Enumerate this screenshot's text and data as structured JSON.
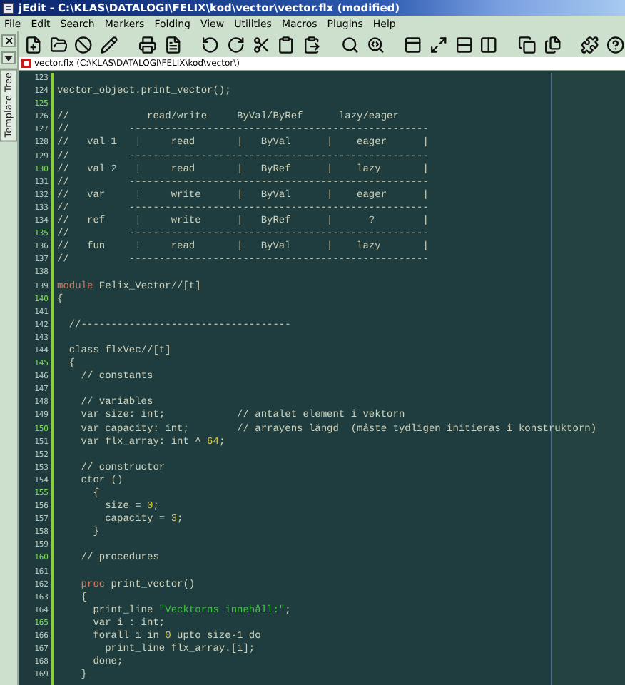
{
  "window": {
    "title": "jEdit - C:\\KLAS\\DATALOGI\\FELIX\\kod\\vector\\vector.flx (modified)"
  },
  "menu": [
    "File",
    "Edit",
    "Search",
    "Markers",
    "Folding",
    "View",
    "Utilities",
    "Macros",
    "Plugins",
    "Help"
  ],
  "dock": {
    "tab": "Template Tree"
  },
  "buffer": {
    "label": "vector.flx (C:\\KLAS\\DATALOGI\\FELIX\\kod\\vector\\)",
    "modified": true
  },
  "lines": [
    {
      "number": "123",
      "highlight": false
    },
    {
      "number": "124",
      "highlight": false,
      "tokens": [
        {
          "kind": "code",
          "text": "vector_object.print_vector();"
        }
      ]
    },
    {
      "number": "125",
      "highlight": true
    },
    {
      "number": "126",
      "highlight": false,
      "tokens": [
        {
          "kind": "code",
          "text": "//             read/write     ByVal/ByRef      lazy/eager"
        }
      ]
    },
    {
      "number": "127",
      "highlight": false,
      "tokens": [
        {
          "kind": "code",
          "text": "//          --------------------------------------------------"
        }
      ]
    },
    {
      "number": "128",
      "highlight": false,
      "tokens": [
        {
          "kind": "code",
          "text": "//   val 1   |     read       |   ByVal      |    eager      |"
        }
      ]
    },
    {
      "number": "129",
      "highlight": false,
      "tokens": [
        {
          "kind": "code",
          "text": "//          --------------------------------------------------"
        }
      ]
    },
    {
      "number": "130",
      "highlight": true,
      "tokens": [
        {
          "kind": "code",
          "text": "//   val 2   |     read       |   ByRef      |    lazy       |"
        }
      ]
    },
    {
      "number": "131",
      "highlight": false,
      "tokens": [
        {
          "kind": "code",
          "text": "//          --------------------------------------------------"
        }
      ]
    },
    {
      "number": "132",
      "highlight": false,
      "tokens": [
        {
          "kind": "code",
          "text": "//   var     |     write      |   ByVal      |    eager      |"
        }
      ]
    },
    {
      "number": "133",
      "highlight": false,
      "tokens": [
        {
          "kind": "code",
          "text": "//          --------------------------------------------------"
        }
      ]
    },
    {
      "number": "134",
      "highlight": false,
      "tokens": [
        {
          "kind": "code",
          "text": "//   ref     |     write      |   ByRef      |      ?        |"
        }
      ]
    },
    {
      "number": "135",
      "highlight": true,
      "tokens": [
        {
          "kind": "code",
          "text": "//          --------------------------------------------------"
        }
      ]
    },
    {
      "number": "136",
      "highlight": false,
      "tokens": [
        {
          "kind": "code",
          "text": "//   fun     |     read       |   ByVal      |    lazy       |"
        }
      ]
    },
    {
      "number": "137",
      "highlight": false,
      "tokens": [
        {
          "kind": "code",
          "text": "//          --------------------------------------------------"
        }
      ]
    },
    {
      "number": "138",
      "highlight": false
    },
    {
      "number": "139",
      "highlight": false,
      "tokens": [
        {
          "kind": "keyword",
          "text": "module"
        },
        {
          "kind": "code",
          "text": " Felix_Vector//[t]"
        }
      ]
    },
    {
      "number": "140",
      "highlight": true,
      "tokens": [
        {
          "kind": "code",
          "text": "{"
        }
      ]
    },
    {
      "number": "141",
      "highlight": false
    },
    {
      "number": "142",
      "highlight": false,
      "tokens": [
        {
          "kind": "code",
          "text": "  //-----------------------------------"
        }
      ]
    },
    {
      "number": "143",
      "highlight": false
    },
    {
      "number": "144",
      "highlight": false,
      "tokens": [
        {
          "kind": "code",
          "text": "  class flxVec//[t]"
        }
      ]
    },
    {
      "number": "145",
      "highlight": true,
      "tokens": [
        {
          "kind": "code",
          "text": "  {"
        }
      ]
    },
    {
      "number": "146",
      "highlight": false,
      "tokens": [
        {
          "kind": "code",
          "text": "    // constants"
        }
      ]
    },
    {
      "number": "147",
      "highlight": false
    },
    {
      "number": "148",
      "highlight": false,
      "tokens": [
        {
          "kind": "code",
          "text": "    // variables"
        }
      ]
    },
    {
      "number": "149",
      "highlight": false,
      "tokens": [
        {
          "kind": "code",
          "text": "    var size: int;            // antalet element i vektorn"
        }
      ]
    },
    {
      "number": "150",
      "highlight": true,
      "tokens": [
        {
          "kind": "code",
          "text": "    var capacity: int;        // arrayens längd  (måste tydligen initieras i konstruktorn)"
        }
      ]
    },
    {
      "number": "151",
      "highlight": false,
      "tokens": [
        {
          "kind": "code",
          "text": "    var flx_array: int ^ "
        },
        {
          "kind": "number",
          "text": "64"
        },
        {
          "kind": "code",
          "text": ";"
        }
      ]
    },
    {
      "number": "152",
      "highlight": false
    },
    {
      "number": "153",
      "highlight": false,
      "tokens": [
        {
          "kind": "code",
          "text": "    // constructor"
        }
      ]
    },
    {
      "number": "154",
      "highlight": false,
      "tokens": [
        {
          "kind": "code",
          "text": "    ctor ()"
        }
      ]
    },
    {
      "number": "155",
      "highlight": true,
      "tokens": [
        {
          "kind": "code",
          "text": "      {"
        }
      ]
    },
    {
      "number": "156",
      "highlight": false,
      "tokens": [
        {
          "kind": "code",
          "text": "        size = "
        },
        {
          "kind": "number",
          "text": "0"
        },
        {
          "kind": "code",
          "text": ";"
        }
      ]
    },
    {
      "number": "157",
      "highlight": false,
      "tokens": [
        {
          "kind": "code",
          "text": "        capacity = "
        },
        {
          "kind": "number",
          "text": "3"
        },
        {
          "kind": "code",
          "text": ";"
        }
      ]
    },
    {
      "number": "158",
      "highlight": false,
      "tokens": [
        {
          "kind": "code",
          "text": "      }"
        }
      ]
    },
    {
      "number": "159",
      "highlight": false
    },
    {
      "number": "160",
      "highlight": true,
      "tokens": [
        {
          "kind": "code",
          "text": "    // procedures"
        }
      ]
    },
    {
      "number": "161",
      "highlight": false
    },
    {
      "number": "162",
      "highlight": false,
      "tokens": [
        {
          "kind": "keyword",
          "text": "    proc"
        },
        {
          "kind": "code",
          "text": " print_vector()"
        }
      ]
    },
    {
      "number": "163",
      "highlight": false,
      "tokens": [
        {
          "kind": "code",
          "text": "    {"
        }
      ]
    },
    {
      "number": "164",
      "highlight": false,
      "tokens": [
        {
          "kind": "code",
          "text": "      print_line "
        },
        {
          "kind": "string",
          "text": "\"Vecktorns innehåll:\""
        },
        {
          "kind": "code",
          "text": ";"
        }
      ]
    },
    {
      "number": "165",
      "highlight": true,
      "tokens": [
        {
          "kind": "code",
          "text": "      var i : int;"
        }
      ]
    },
    {
      "number": "166",
      "highlight": false,
      "tokens": [
        {
          "kind": "code",
          "text": "      forall i in "
        },
        {
          "kind": "number",
          "text": "0"
        },
        {
          "kind": "code",
          "text": " upto size-1 do"
        }
      ]
    },
    {
      "number": "167",
      "highlight": false,
      "tokens": [
        {
          "kind": "code",
          "text": "        print_line flx_array.[i];"
        }
      ]
    },
    {
      "number": "168",
      "highlight": false,
      "tokens": [
        {
          "kind": "code",
          "text": "      done;"
        }
      ]
    },
    {
      "number": "169",
      "highlight": false,
      "tokens": [
        {
          "kind": "code",
          "text": "    }"
        }
      ]
    }
  ]
}
